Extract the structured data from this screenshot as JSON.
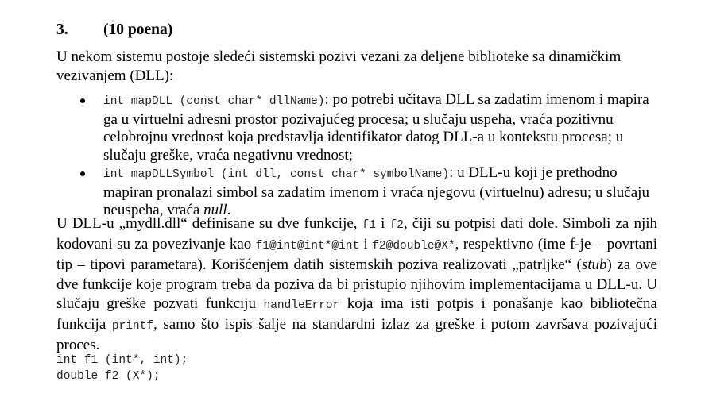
{
  "heading": {
    "number": "3.",
    "points": "(10 poena)"
  },
  "intro": {
    "text": "U nekom sistemu postoje sledeći sistemski pozivi vezani za deljene biblioteke sa dinamičkim vezivanjem (DLL):"
  },
  "bullets": [
    {
      "signature": "int mapDLL (const char* dllName)",
      "description": ": po potrebi učitava DLL sa zadatim imenom i mapira ga u virtuelni adresni prostor pozivajućeg procesa; u slučaju uspeha, vraća pozitivnu celobrojnu vrednost koja predstavlja identifikator datog DLL-a u kontekstu procesa; u slučaju greške, vraća negativnu vrednost;"
    },
    {
      "signature": "int mapDLLSymbol (int dll, const char* symbolName)",
      "description": ": u DLL-u koji je prethodno mapiran pronalazi simbol sa zadatim imenom i vraća njegovu (virtuelnu) adresu; u slučaju neuspeha, vraća ",
      "description_end": "null",
      "description_tail": "."
    }
  ],
  "body": {
    "t1": "U DLL-u „mydll.dll“ definisane su dve funkcije, ",
    "f1": "f1",
    "t2": " i ",
    "f2": "f2",
    "t3": ", čiji su potpisi dati dole. Simboli za njih kodovani su za povezivanje kao ",
    "mangled1": "f1@int@int*@int",
    "t4": " i ",
    "mangled2": "f2@double@X*",
    "t5": ", respektivno (ime f-je – povrtani tip – tipovi parametara). Korišćenjem datih sistemskih poziva realizovati „patrljke“ (",
    "stub": "stub",
    "t6": ") za ove dve funkcije koje program treba da poziva da bi pristupio njihovim implementacijama u DLL-u. U slučaju greške pozvati funkciju ",
    "handle_error": "handleError",
    "t7": " koja ima isti potpis i ponašanje kao bibliotečna funkcija ",
    "printf": "printf",
    "t8": ", samo što ispis šalje na standardni izlaz za greške i potom završava pozivajući proces."
  },
  "code_lines": [
    "int f1 (int*, int);",
    "double f2 (X*);"
  ]
}
